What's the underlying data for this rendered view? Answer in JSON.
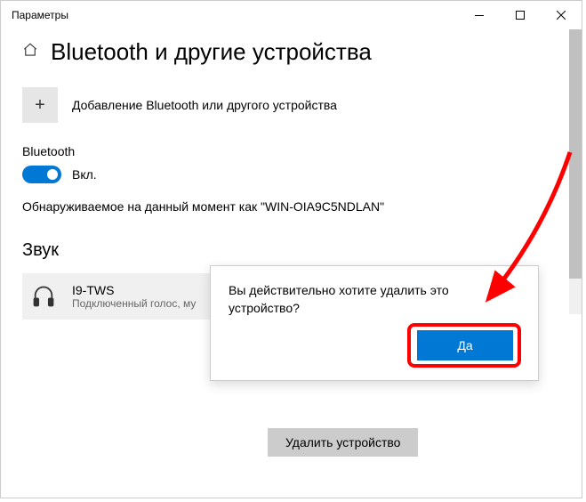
{
  "window": {
    "title": "Параметры"
  },
  "page": {
    "title": "Bluetooth и другие устройства"
  },
  "add_device": {
    "label": "Добавление Bluetooth или другого устройства"
  },
  "bluetooth": {
    "section_label": "Bluetooth",
    "toggle_state": "Вкл.",
    "discoverable_text": "Обнаруживаемое на данный момент как \"WIN-OIA9C5NDLAN\""
  },
  "sound": {
    "heading": "Звук",
    "device": {
      "name": "I9-TWS",
      "status": "Подключенный голос, му"
    }
  },
  "remove_button": {
    "label": "Удалить устройство"
  },
  "confirm": {
    "message": "Вы действительно хотите удалить это устройство?",
    "yes_label": "Да"
  }
}
